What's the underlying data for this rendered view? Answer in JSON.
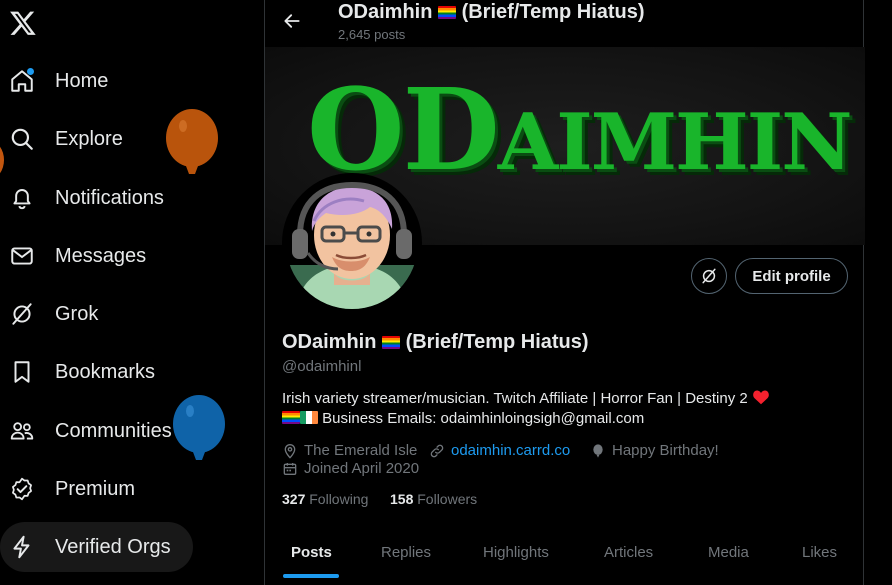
{
  "colors": {
    "accent": "#1d9bf0",
    "background": "#000000",
    "text": "#e7e9ea",
    "muted": "#71767b",
    "banner_green": "#19b52b",
    "heart": "#f91880"
  },
  "sidebar": {
    "logo_icon": "x-logo-icon",
    "items": [
      {
        "label": "Home",
        "icon": "home-icon",
        "notification_dot": true
      },
      {
        "label": "Explore",
        "icon": "search-icon"
      },
      {
        "label": "Notifications",
        "icon": "bell-icon"
      },
      {
        "label": "Messages",
        "icon": "envelope-icon"
      },
      {
        "label": "Grok",
        "icon": "grok-icon"
      },
      {
        "label": "Bookmarks",
        "icon": "bookmark-icon"
      },
      {
        "label": "Communities",
        "icon": "people-icon"
      },
      {
        "label": "Premium",
        "icon": "verified-badge-icon"
      },
      {
        "label": "Verified Orgs",
        "icon": "lightning-icon"
      }
    ],
    "balloons": [
      "orange",
      "blue"
    ]
  },
  "header": {
    "title": "ODaimhin 🏳️‍🌈 (Brief/Temp Hiatus)",
    "title_text": "ODaimhin",
    "title_suffix": "(Brief/Temp Hiatus)",
    "post_count": "2,645 posts"
  },
  "banner": {
    "text": "ODaimhin",
    "first": "OD",
    "rest": "AIMHIN"
  },
  "profile": {
    "display_name": "ODaimhin",
    "name_suffix": "(Brief/Temp Hiatus)",
    "handle": "@odaimhinl",
    "bio_line1": "Irish variety streamer/musician. Twitch Affiliate | Horror Fan | Destiny 2",
    "bio_line2": "Business Emails: odaimhinloingsigh@gmail.com",
    "location": "The Emerald Isle",
    "website": "odaimhin.carrd.co",
    "birthday": "Happy Birthday!",
    "joined": "Joined April 2020",
    "following_count": "327",
    "following_label": "Following",
    "followers_count": "158",
    "followers_label": "Followers",
    "edit_button": "Edit profile"
  },
  "tabs": [
    {
      "label": "Posts",
      "active": true
    },
    {
      "label": "Replies"
    },
    {
      "label": "Highlights"
    },
    {
      "label": "Articles"
    },
    {
      "label": "Media"
    },
    {
      "label": "Likes"
    }
  ]
}
